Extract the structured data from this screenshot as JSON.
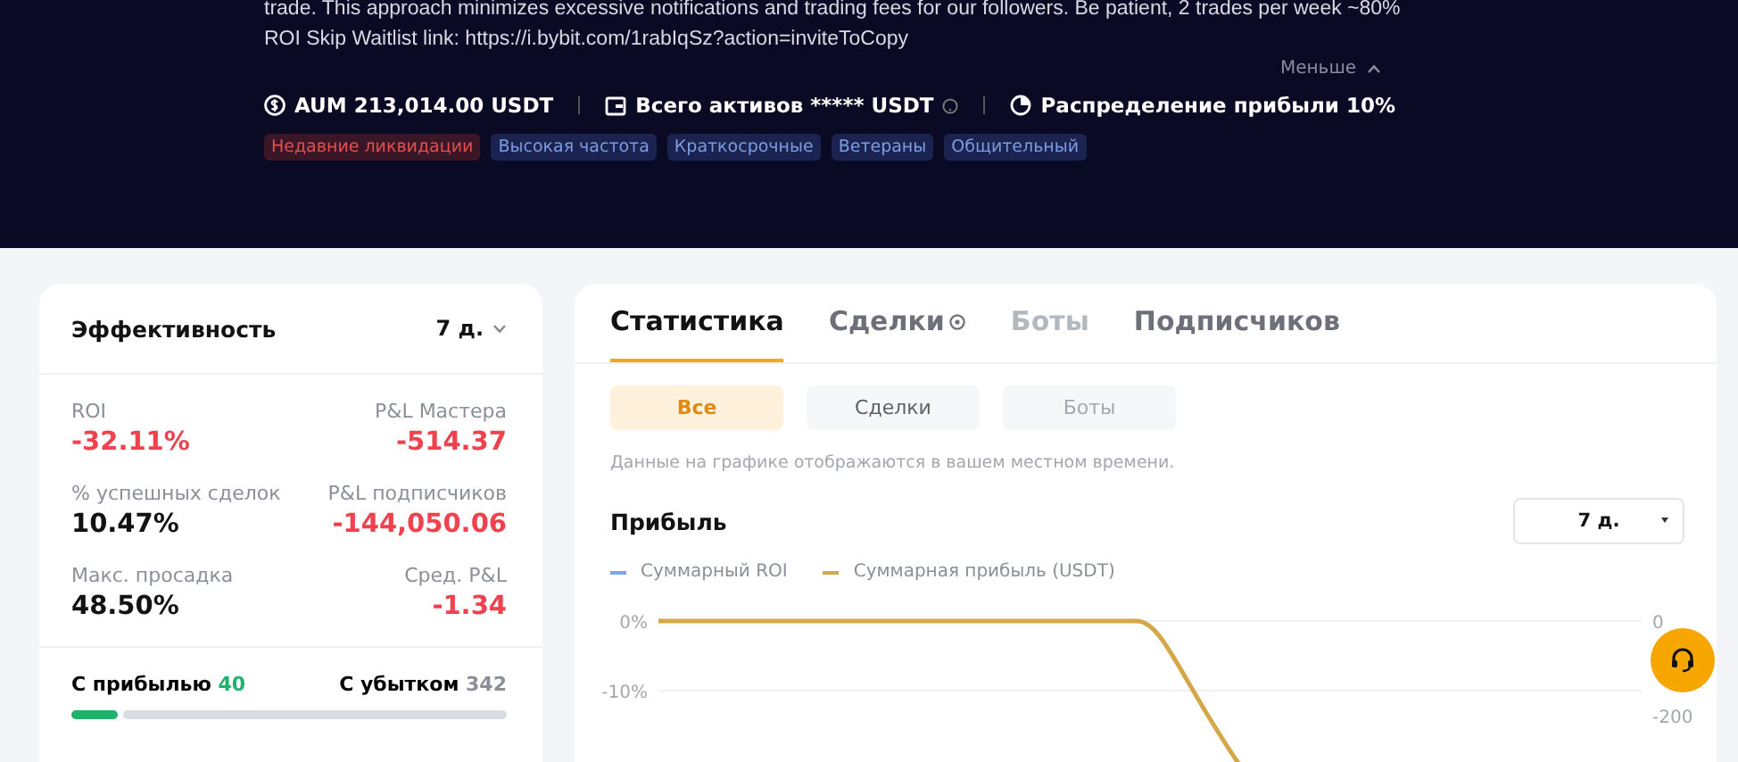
{
  "profile": {
    "description_lines": [
      "trade. This approach minimizes excessive notifications and trading fees for our followers. Be patient, 2 trades per week ~80%",
      "ROI Skip Waitlist link: https://i.bybit.com/1rabIqSz?action=inviteToCopy"
    ],
    "collapse_label": "Меньше",
    "stats": [
      {
        "kind": "coin",
        "text": "AUM 213,014.00 USDT",
        "info": false
      },
      {
        "kind": "wallet",
        "text": "Всего активов ***** USDT",
        "info": true
      },
      {
        "kind": "pie",
        "text": "Распределение прибыли 10%",
        "info": false
      }
    ],
    "tags": [
      {
        "label": "Недавние ликвидации",
        "kind": "warning"
      },
      {
        "label": "Высокая частота",
        "kind": "normal"
      },
      {
        "label": "Краткосрочные",
        "kind": "normal"
      },
      {
        "label": "Ветераны",
        "kind": "normal"
      },
      {
        "label": "Общительный",
        "kind": "normal"
      }
    ]
  },
  "performance": {
    "title": "Эффективность",
    "period": "7 д.",
    "metrics": [
      {
        "label": "ROI",
        "value": "-32.11%",
        "negative": true
      },
      {
        "label": "P&L Мастера",
        "value": "-514.37",
        "negative": true
      },
      {
        "label": "% успешных сделок",
        "value": "10.47%",
        "negative": false
      },
      {
        "label": "P&L подписчиков",
        "value": "-144,050.06",
        "negative": true
      },
      {
        "label": "Макс. просадка",
        "value": "48.50%",
        "negative": false
      },
      {
        "label": "Сред. P&L",
        "value": "-1.34",
        "negative": true
      }
    ],
    "wins_label": "С прибылью",
    "wins": "40",
    "losses_label": "С убытком",
    "losses": "342",
    "level": 0.105
  },
  "stats_panel": {
    "tabs": [
      {
        "label": "Статистика",
        "selected": true,
        "disabled": false,
        "info": false
      },
      {
        "label": "Сделки",
        "selected": false,
        "disabled": false,
        "info": true
      },
      {
        "label": "Боты",
        "selected": false,
        "disabled": true,
        "info": false
      },
      {
        "label": "Подписчиков",
        "selected": false,
        "disabled": false,
        "info": false
      }
    ],
    "filters": [
      {
        "label": "Все",
        "selected": true,
        "disabled": false
      },
      {
        "label": "Сделки",
        "selected": false,
        "disabled": false
      },
      {
        "label": "Боты",
        "selected": false,
        "disabled": true
      }
    ],
    "note": "Данные на графике отображаются в вашем местном времени.",
    "chart_title": "Прибыль",
    "chart_period": "7 д.",
    "chart": {
      "legend": [
        {
          "name": "Суммарный ROI",
          "color": "#7aa7f0"
        },
        {
          "name": "Суммарная прибыль (USDT)",
          "color": "#d4a84a"
        }
      ],
      "left_ticks": [
        "0%",
        "-10%"
      ],
      "right_ticks": [
        "0",
        "-200"
      ]
    }
  }
}
